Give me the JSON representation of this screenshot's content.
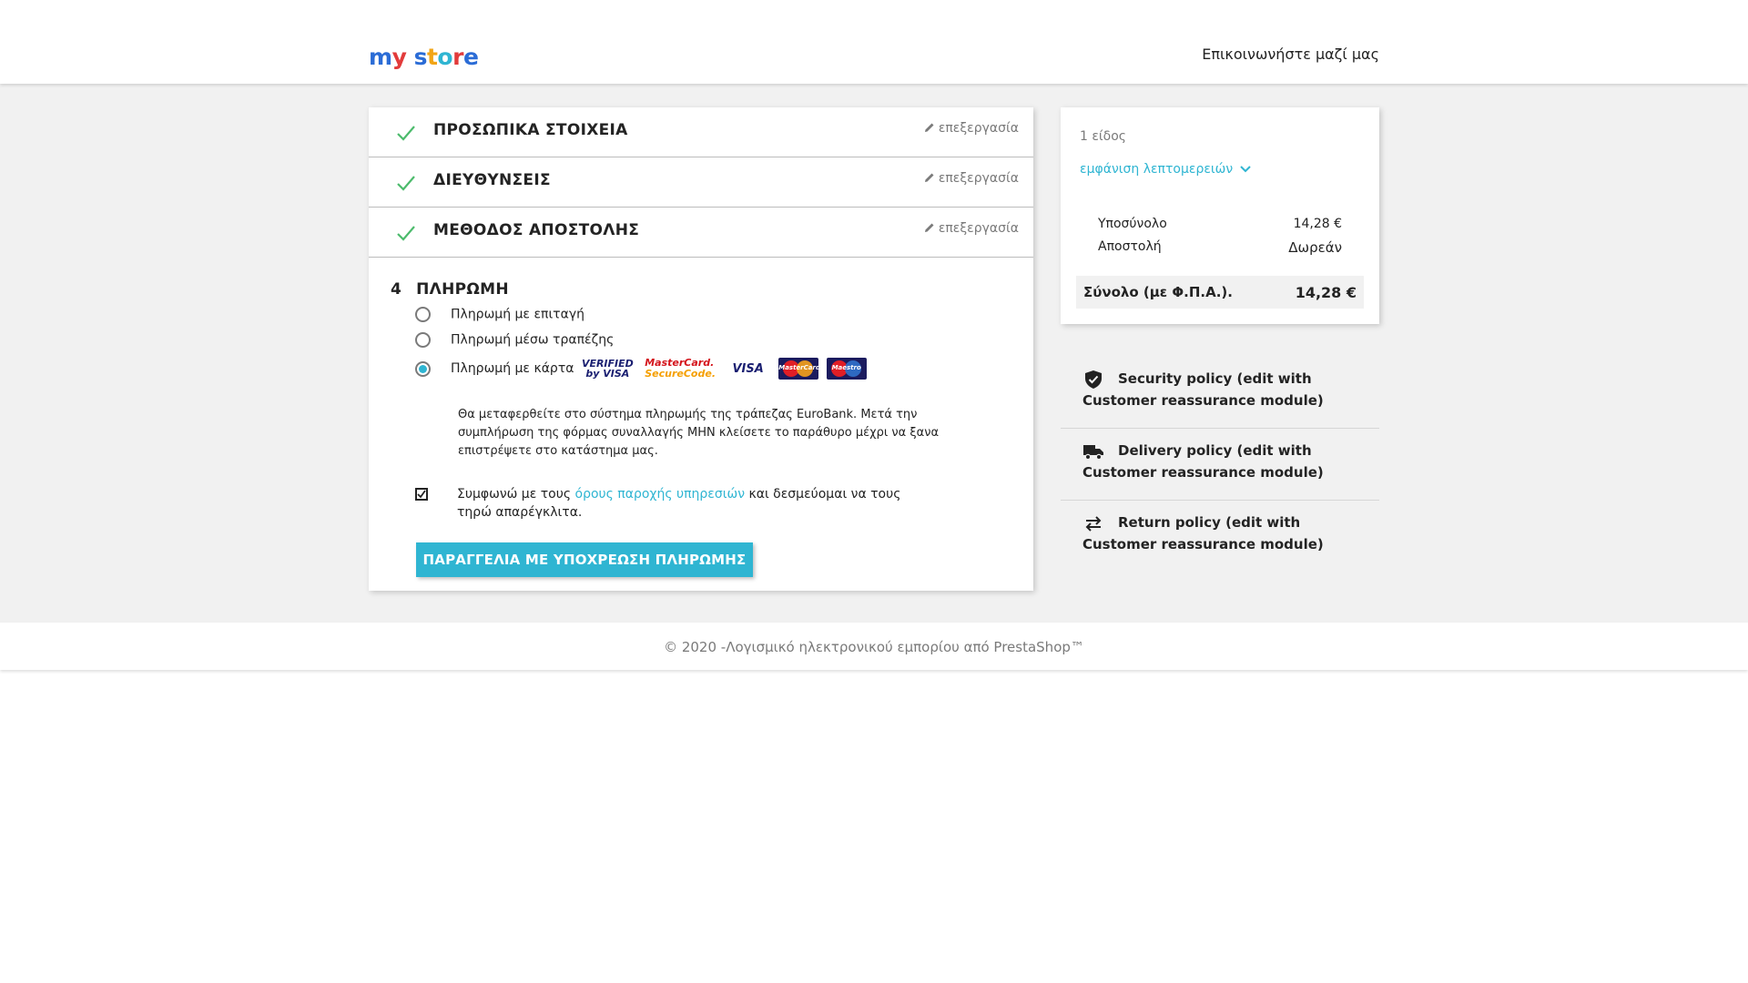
{
  "header": {
    "logo": {
      "letters": [
        {
          "ch": "m",
          "color": "#2b6cd6"
        },
        {
          "ch": "y",
          "color": "#e23b3b"
        },
        {
          "ch": " ",
          "color": "#000"
        },
        {
          "ch": "s",
          "color": "#2b6cd6"
        },
        {
          "ch": "t",
          "color": "#f2a516"
        },
        {
          "ch": "o",
          "color": "#2fb5d2"
        },
        {
          "ch": "r",
          "color": "#e23b3b"
        },
        {
          "ch": "e",
          "color": "#2b6cd6"
        }
      ]
    },
    "contact_label": "Επικοινωνήστε μαζί μας"
  },
  "steps": [
    {
      "title": "ΠΡΟΣΩΠΙΚΑ ΣΤΟΙΧΕΙΑ",
      "edit_label": "επεξεργασία"
    },
    {
      "title": "ΔΙΕΥΘΥΝΣΕΙΣ",
      "edit_label": "επεξεργασία"
    },
    {
      "title": "ΜΕΘΟΔΟΣ ΑΠΟΣΤΟΛΗΣ",
      "edit_label": "επεξεργασία"
    }
  ],
  "payment": {
    "number": "4",
    "title": "ΠΛΗΡΩΜΗ",
    "options": [
      {
        "label": "Πληρωμή με επιταγή",
        "selected": false
      },
      {
        "label": "Πληρωμή μέσω τραπέζης",
        "selected": false
      },
      {
        "label": "Πληρωμή με κάρτα",
        "selected": true
      }
    ],
    "card_logos": {
      "verified_line1": "VERIFIED",
      "verified_line2": "by VISA",
      "mc_line1": "MasterCard.",
      "mc_line2": "SecureCode.",
      "visa": "VISA",
      "mastercard": "MasterCard",
      "maestro": "Maestro"
    },
    "description": "Θα μεταφερθείτε στο σύστημα πληρωμής της τράπεζας EuroBank. Μετά την συμπλήρωση της φόρμας συναλλαγής ΜΗΝ κλείσετε το παράθυρο μέχρι να ξανα επιστρέψετε στο κατάστημα μας.",
    "terms_before": "Συμφωνώ με τους ",
    "terms_link": "όρους παροχής υπηρεσιών",
    "terms_after": " και δεσμεύομαι να τους τηρώ απαρέγκλιτα.",
    "terms_checked": true,
    "order_button": "ΠΑΡΑΓΓΕΛΙΑ ΜΕ ΥΠΟΧΡΕΩΣΗ ΠΛΗΡΩΜΗΣ"
  },
  "summary": {
    "items_count": "1 είδος",
    "details_link": "εμφάνιση λεπτομερειών",
    "subtotal_label": "Υποσύνολο",
    "subtotal_value": "14,28 €",
    "shipping_label": "Αποστολή",
    "shipping_value": "Δωρεάν",
    "total_label": "Σύνολο (με Φ.Π.Α.).",
    "total_value": "14,28 €"
  },
  "reassurance": [
    {
      "icon": "shield-icon",
      "text": "Security policy (edit with Customer reassurance module)"
    },
    {
      "icon": "truck-icon",
      "text": "Delivery policy (edit with Customer reassurance module)"
    },
    {
      "icon": "swap-arrows-icon",
      "text": "Return policy (edit with Customer reassurance module)"
    }
  ],
  "footer": {
    "copyright": "© 2020 -Λογισμικό ηλεκτρονικού εμπορίου από PrestaShop™"
  },
  "colors": {
    "accent": "#2fb5d2",
    "check": "#4cbb6c",
    "background": "#f1f1f1"
  }
}
